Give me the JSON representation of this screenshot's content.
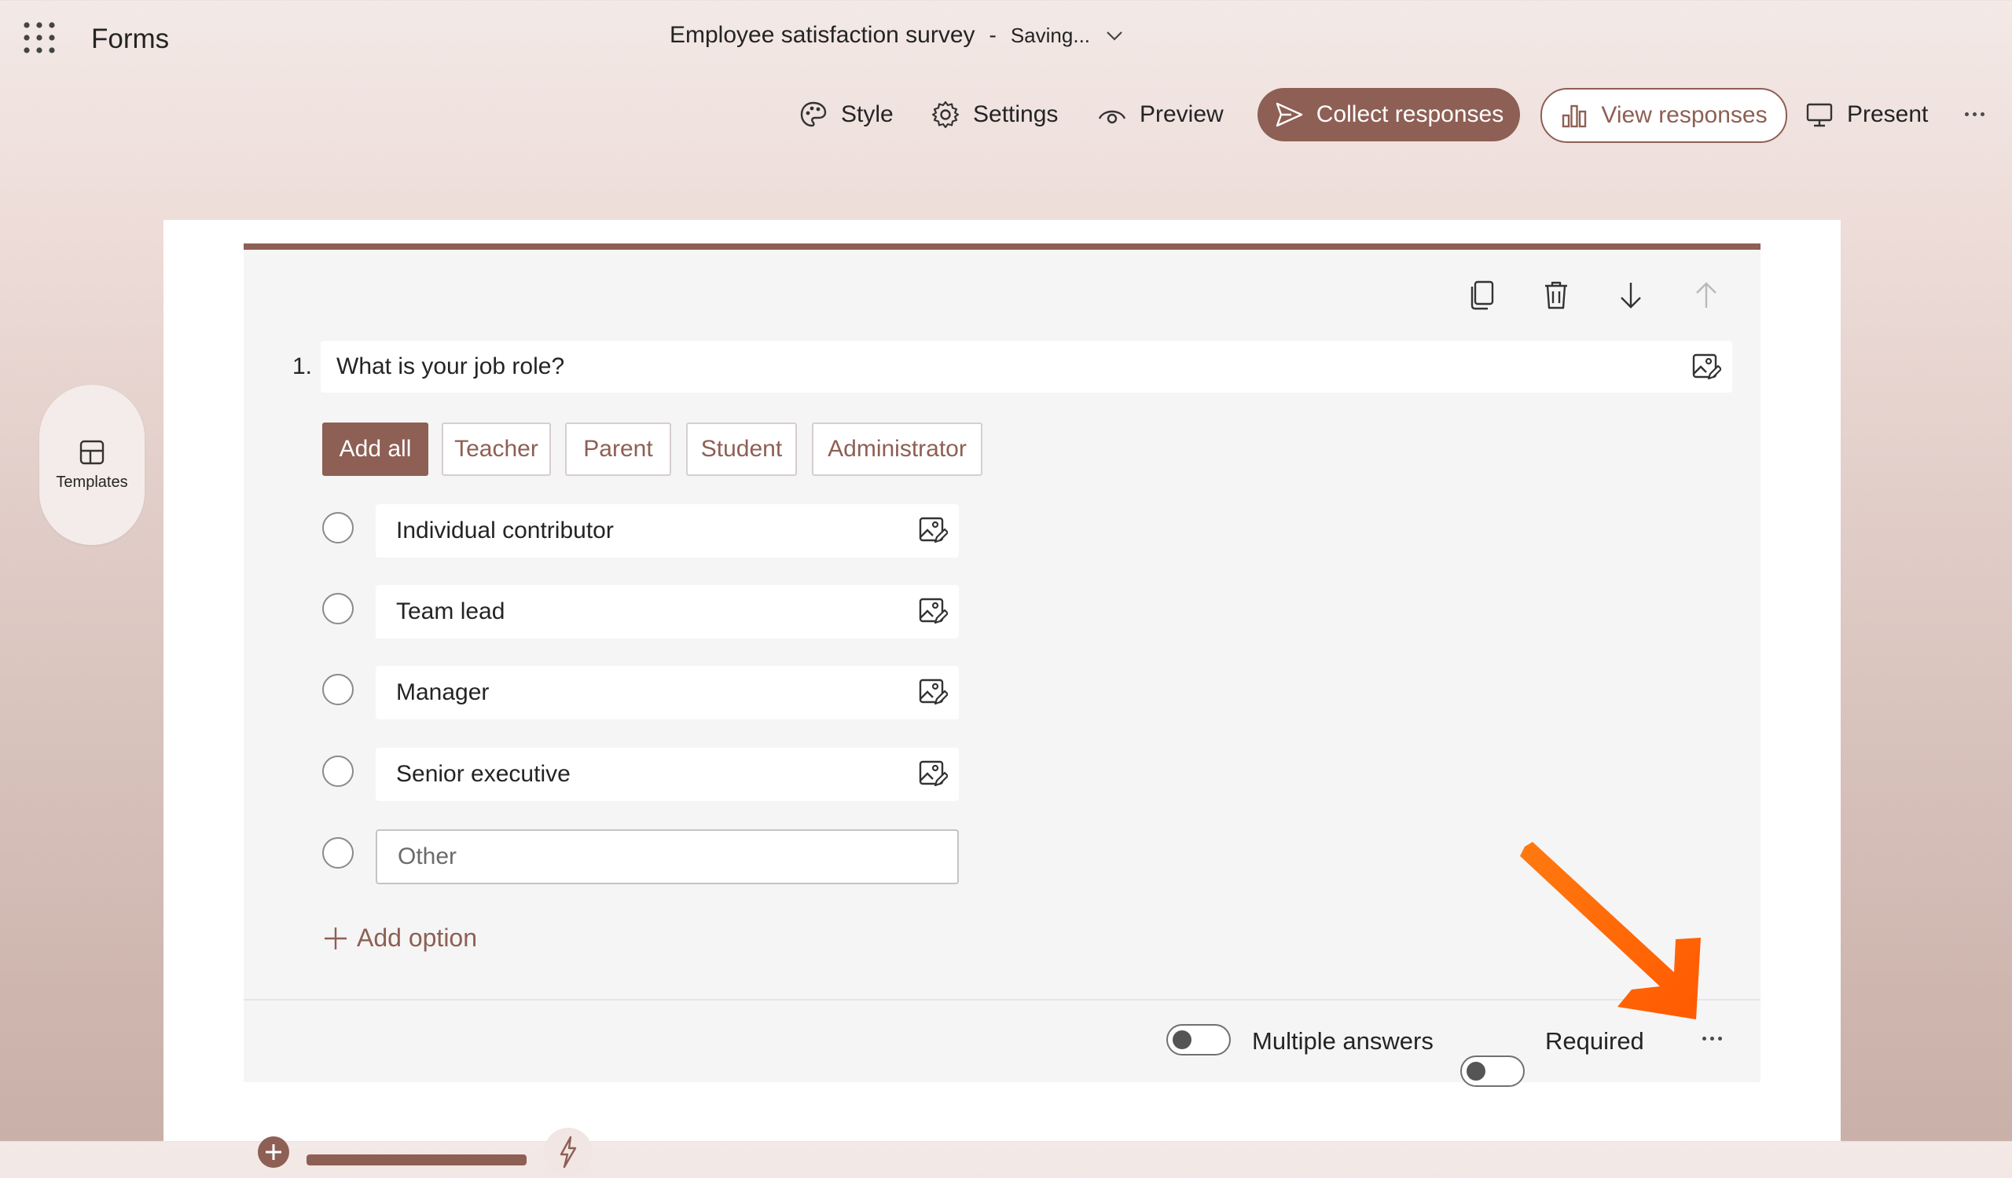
{
  "app": {
    "name": "Forms"
  },
  "form": {
    "title": "Employee satisfaction survey",
    "separator": "-",
    "status": "Saving..."
  },
  "toolbar": {
    "style": "Style",
    "settings": "Settings",
    "preview": "Preview",
    "collect": "Collect responses",
    "view": "View responses",
    "present": "Present"
  },
  "sidebar": {
    "templates": "Templates"
  },
  "question": {
    "number": "1.",
    "text": "What is your job role?",
    "suggestions": [
      "Add all",
      "Teacher",
      "Parent",
      "Student",
      "Administrator"
    ],
    "options": [
      "Individual contributor",
      "Team lead",
      "Manager",
      "Senior executive"
    ],
    "other_placeholder": "Other",
    "add_option": "Add option",
    "multiple_answers": "Multiple answers",
    "required": "Required"
  },
  "colors": {
    "accent": "#8e5f54",
    "arrow": "#ff6a00"
  },
  "icons": [
    "waffle-icon",
    "chevron-down-icon",
    "palette-icon",
    "gear-icon",
    "eye-icon",
    "send-icon",
    "bar-chart-icon",
    "monitor-icon",
    "more-icon",
    "templates-icon",
    "copy-icon",
    "trash-icon",
    "arrow-down-icon",
    "arrow-up-icon",
    "image-edit-icon",
    "plus-icon"
  ]
}
